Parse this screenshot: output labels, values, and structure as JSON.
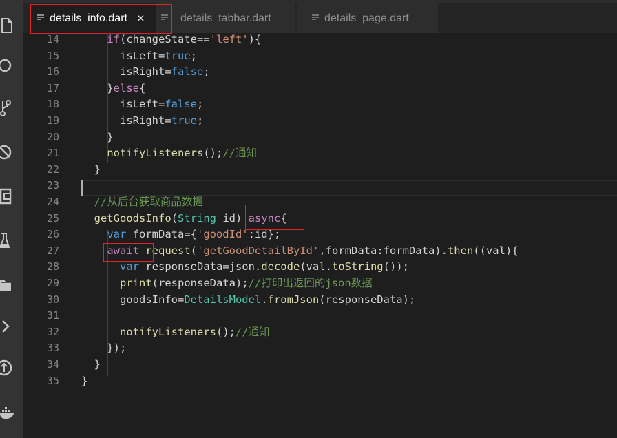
{
  "tabs": [
    {
      "label": "details_info.dart",
      "close": "×",
      "active": true
    },
    {
      "label": "details_tabbar.dart",
      "active": false
    },
    {
      "label": "details_page.dart",
      "active": false
    }
  ],
  "activity_bar": [
    "explorer-icon",
    "search-icon",
    "source-control-icon",
    "debug-icon",
    "extensions-icon",
    "test-flask-icon",
    "folder-icon",
    "chevron-right-icon",
    "git-remote-icon",
    "docker-icon"
  ],
  "editor": {
    "lines": [
      {
        "num": "14",
        "text": "    if(changeState=='left'){"
      },
      {
        "num": "15",
        "text": "      isLeft=true;"
      },
      {
        "num": "16",
        "text": "      isRight=false;"
      },
      {
        "num": "17",
        "text": "    }else{"
      },
      {
        "num": "18",
        "text": "      isLeft=false;"
      },
      {
        "num": "19",
        "text": "      isRight=true;"
      },
      {
        "num": "20",
        "text": "    }"
      },
      {
        "num": "21",
        "text": "    notifyListeners();//通知"
      },
      {
        "num": "22",
        "text": "  }"
      },
      {
        "num": "23",
        "text": ""
      },
      {
        "num": "24",
        "text": "  //从后台获取商品数据"
      },
      {
        "num": "25",
        "text": "  getGoodsInfo(String id) async{"
      },
      {
        "num": "26",
        "text": "    var formData={'goodId':id};"
      },
      {
        "num": "27",
        "text": "    await request('getGoodDetailById',formData:formData).then((val){"
      },
      {
        "num": "28",
        "text": "      var responseData=json.decode(val.toString());"
      },
      {
        "num": "29",
        "text": "      print(responseData);//打印出返回的json数据"
      },
      {
        "num": "30",
        "text": "      goodsInfo=DetailsModel.fromJson(responseData);"
      },
      {
        "num": "31",
        "text": ""
      },
      {
        "num": "32",
        "text": "      notifyListeners();//通知"
      },
      {
        "num": "33",
        "text": "    });"
      },
      {
        "num": "34",
        "text": "  }"
      },
      {
        "num": "35",
        "text": "}"
      }
    ]
  },
  "colors": {
    "background": "#1e1e1e",
    "keyword": "#569cd6",
    "function": "#dcdcaa",
    "string": "#ce9178",
    "comment": "#6a9955",
    "type": "#4ec9b0",
    "control": "#c586c0",
    "highlight_box": "#e0242a"
  }
}
